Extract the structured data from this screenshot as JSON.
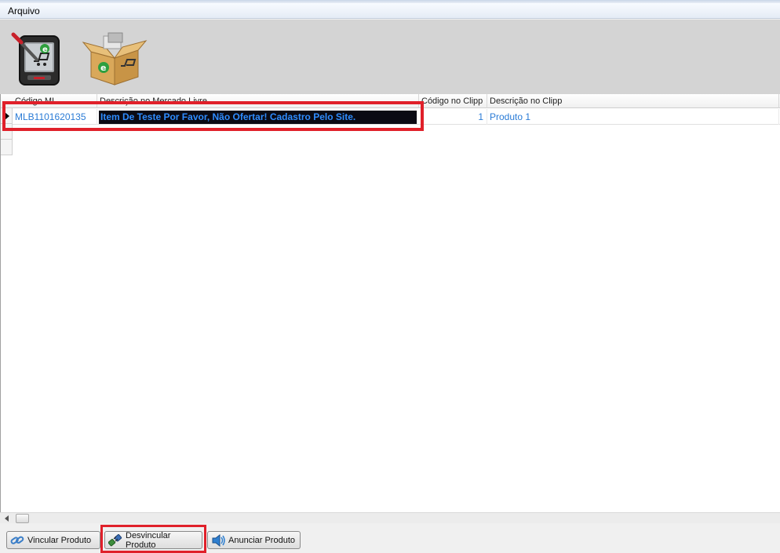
{
  "menu": {
    "file_label": "Arquivo"
  },
  "toolbar": {
    "tool1_icon": "pda-stylus-icon",
    "tool2_icon": "product-box-icon"
  },
  "grid": {
    "columns": [
      "Código ML",
      "Descrição no Mercado Livre",
      "Código no Clipp",
      "Descrição no Clipp"
    ],
    "rows": [
      {
        "codigo_ml": "MLB1101620135",
        "descricao_ml": "Item De Teste Por Favor, Não Ofertar! Cadastro Pelo Site.",
        "codigo_clipp": "1",
        "descricao_clipp": "Produto 1"
      }
    ]
  },
  "buttons": {
    "vincular": "Vincular Produto",
    "desvincular": "Desvincular Produto",
    "anunciar": "Anunciar Produto"
  },
  "colors": {
    "highlight": "#e0202a",
    "link_text": "#2a7bd6",
    "selected_bg": "#0a0a14"
  }
}
